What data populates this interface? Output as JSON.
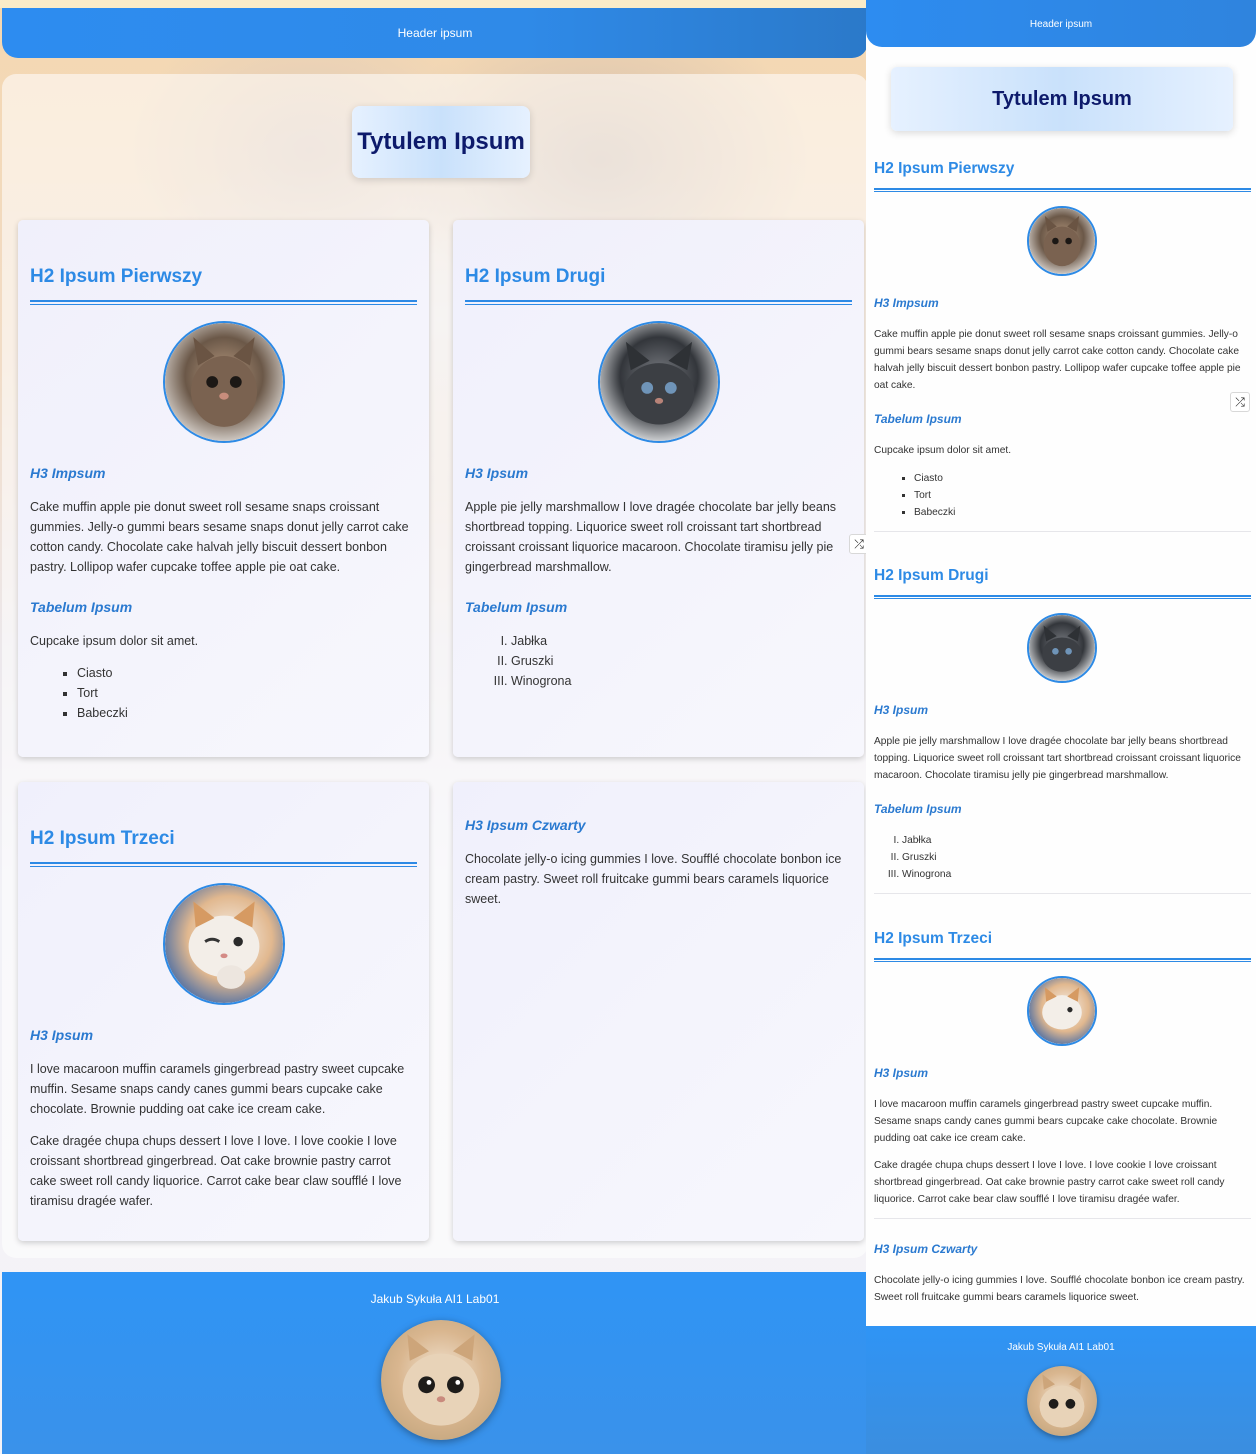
{
  "header": {
    "text": "Header ipsum"
  },
  "title": "Tytulem Ipsum",
  "sections": [
    {
      "h2": "H2 Ipsum Pierwszy",
      "image": "kitten-photo-1",
      "h3": "H3 Impsum",
      "paragraph": "Cake muffin apple pie donut sweet roll sesame snaps croissant gummies. Jelly-o gummi bears sesame snaps donut jelly carrot cake cotton candy. Chocolate cake halvah jelly biscuit dessert bonbon pastry. Lollipop wafer cupcake toffee apple pie oat cake.",
      "list_title": "Tabelum Ipsum",
      "list_intro": "Cupcake ipsum dolor sit amet.",
      "list_type": "unordered",
      "list": [
        "Ciasto",
        "Tort",
        "Babeczki"
      ]
    },
    {
      "h2": "H2 Ipsum Drugi",
      "image": "kitten-photo-2",
      "h3": "H3 Ipsum",
      "paragraph": "Apple pie jelly marshmallow I love dragée chocolate bar jelly beans shortbread topping. Liquorice sweet roll croissant tart shortbread croissant croissant liquorice macaroon. Chocolate tiramisu jelly pie gingerbread marshmallow.",
      "list_title": "Tabelum Ipsum",
      "list_type": "ordered-roman",
      "list": [
        "Jabłka",
        "Gruszki",
        "Winogrona"
      ]
    },
    {
      "h2": "H2 Ipsum Trzeci",
      "image": "kitten-photo-3",
      "h3": "H3 Ipsum",
      "paragraphs": [
        "I love macaroon muffin caramels gingerbread pastry sweet cupcake muffin. Sesame snaps candy canes gummi bears cupcake cake chocolate. Brownie pudding oat cake ice cream cake.",
        "Cake dragée chupa chups dessert I love I love. I love cookie I love croissant shortbread gingerbread. Oat cake brownie pastry carrot cake sweet roll candy liquorice. Carrot cake bear claw soufflé I love tiramisu dragée wafer."
      ]
    },
    {
      "h3": "H3 Ipsum Czwarty",
      "paragraph": "Chocolate jelly-o icing gummies I love. Soufflé chocolate bonbon ice cream pastry. Sweet roll fruitcake gummi bears caramels liquorice sweet."
    }
  ],
  "footer": {
    "text": "Jakub Sykuła AI1 Lab01",
    "image": "cat-photo-footer"
  },
  "icons": {
    "shuffle": "shuffle-icon"
  },
  "colors": {
    "accent": "#2d8ae5",
    "header": "#2d8cf0",
    "title_text": "#0d1a6b",
    "h3": "#2b7ad0"
  }
}
